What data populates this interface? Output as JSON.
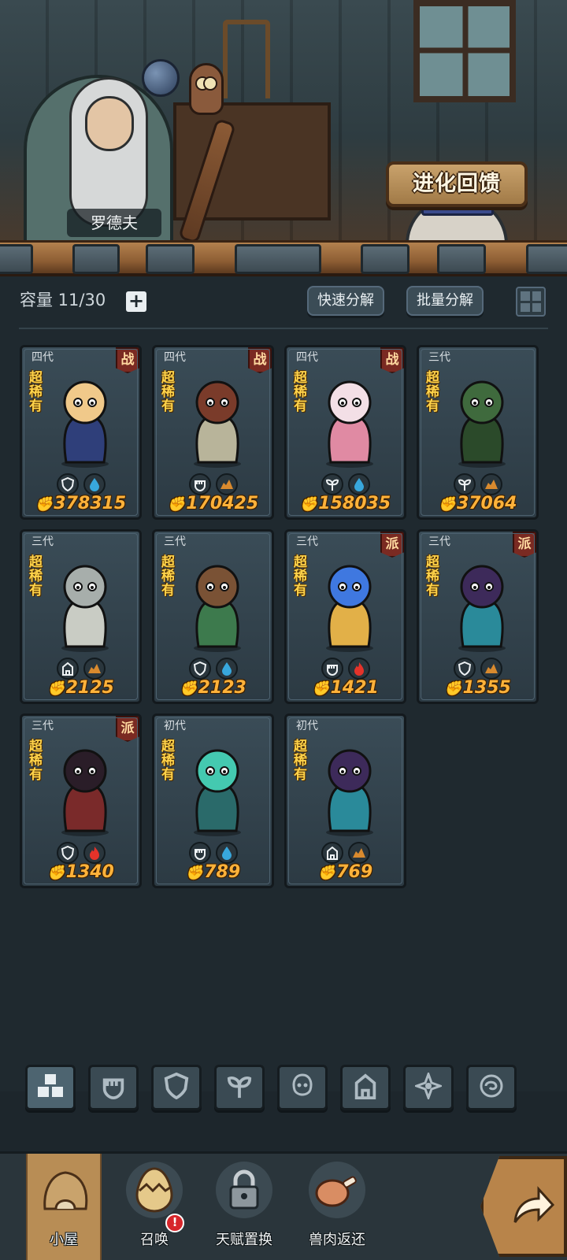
{
  "header": {
    "npc_name": "罗德夫",
    "evolve_button": "进化回馈"
  },
  "toolbar": {
    "capacity_label": "容量 11/30",
    "quick_dismantle": "快速分解",
    "batch_dismantle": "批量分解"
  },
  "cards": [
    {
      "gen": "四代",
      "rarity": "超稀有",
      "role": "战",
      "power": "378315",
      "monster": "fox-girl",
      "tags": [
        "shield-icon",
        "water-icon"
      ]
    },
    {
      "gen": "四代",
      "rarity": "超稀有",
      "role": "战",
      "power": "170425",
      "monster": "hooded-blob",
      "tags": [
        "fist-icon",
        "earth-icon"
      ]
    },
    {
      "gen": "四代",
      "rarity": "超稀有",
      "role": "战",
      "power": "158035",
      "monster": "sheep-worm",
      "tags": [
        "sprout-icon",
        "water-icon"
      ]
    },
    {
      "gen": "三代",
      "rarity": "超稀有",
      "role": "",
      "power": "37064",
      "monster": "moss-golem",
      "tags": [
        "sprout-icon",
        "earth-icon"
      ]
    },
    {
      "gen": "三代",
      "rarity": "超稀有",
      "role": "",
      "power": "2125",
      "monster": "armored-mouse",
      "tags": [
        "castle-icon",
        "earth-icon"
      ]
    },
    {
      "gen": "三代",
      "rarity": "超稀有",
      "role": "",
      "power": "2123",
      "monster": "tree-spirit",
      "tags": [
        "shield-icon",
        "water-icon"
      ]
    },
    {
      "gen": "三代",
      "rarity": "超稀有",
      "role": "派",
      "power": "1421",
      "monster": "blue-flame-spirit",
      "tags": [
        "fist-icon",
        "fire-icon"
      ]
    },
    {
      "gen": "三代",
      "rarity": "超稀有",
      "role": "派",
      "power": "1355",
      "monster": "dark-witch",
      "tags": [
        "shield-icon",
        "earth-icon"
      ]
    },
    {
      "gen": "三代",
      "rarity": "超稀有",
      "role": "派",
      "power": "1340",
      "monster": "horned-beast",
      "tags": [
        "shield-icon",
        "fire-icon"
      ]
    },
    {
      "gen": "初代",
      "rarity": "超稀有",
      "role": "",
      "power": "789",
      "monster": "water-serpent",
      "tags": [
        "fist-icon",
        "water-icon"
      ]
    },
    {
      "gen": "初代",
      "rarity": "超稀有",
      "role": "",
      "power": "769",
      "monster": "dark-witch",
      "tags": [
        "castle-icon",
        "earth-icon"
      ]
    }
  ],
  "filters": [
    "all-icon",
    "fist-icon",
    "shield-icon",
    "sprout-icon",
    "spirit-icon",
    "castle-icon",
    "crosshair-icon",
    "swirl-icon"
  ],
  "nav": [
    {
      "label": "小屋",
      "icon": "hut-icon",
      "active": true,
      "alert": ""
    },
    {
      "label": "召唤",
      "icon": "egg-icon",
      "active": false,
      "alert": "!"
    },
    {
      "label": "天赋置换",
      "icon": "lock-icon",
      "active": false,
      "alert": ""
    },
    {
      "label": "兽肉返还",
      "icon": "meat-icon",
      "active": false,
      "alert": ""
    }
  ],
  "colors": {
    "panel": "#1f292f",
    "power": "#ffb23a",
    "rarity": "#ffd34a",
    "role_badge": "#7a2a22",
    "nav_active": "#b88d55"
  }
}
